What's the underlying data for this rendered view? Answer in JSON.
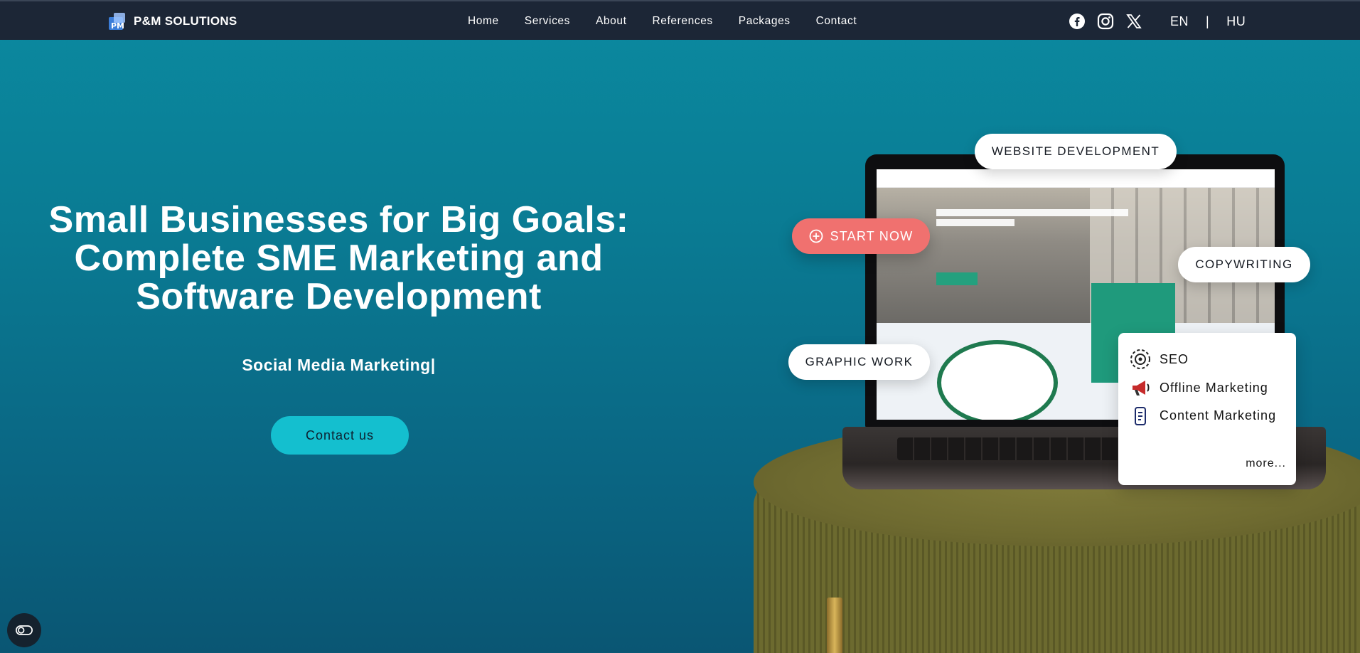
{
  "brand": {
    "name": "P&M SOLUTIONS"
  },
  "nav": {
    "items": [
      "Home",
      "Services",
      "About",
      "References",
      "Packages",
      "Contact"
    ]
  },
  "social": [
    "facebook-icon",
    "instagram-icon",
    "x-icon"
  ],
  "lang": {
    "en": "EN",
    "separator": "|",
    "hu": "HU"
  },
  "hero": {
    "title": "Small Businesses for Big Goals: Complete SME Marketing and Software Development",
    "typing_text": "Social Media Marketing|",
    "cta": "Contact us"
  },
  "showcase": {
    "start_button": "START NOW",
    "pills": {
      "web": "WEBSITE DEVELOPMENT",
      "copy": "COPYWRITING",
      "graphic": "GRAPHIC WORK"
    },
    "services": [
      {
        "label": "SEO",
        "icon": "seo-icon"
      },
      {
        "label": "Offline Marketing",
        "icon": "megaphone-icon"
      },
      {
        "label": "Content Marketing",
        "icon": "content-icon"
      }
    ],
    "more": "more..."
  },
  "colors": {
    "navbar": "#1c2636",
    "hero_top": "#0b8aa0",
    "hero_bottom": "#0a5673",
    "cta": "#14bfcf",
    "start": "#f0716f"
  }
}
